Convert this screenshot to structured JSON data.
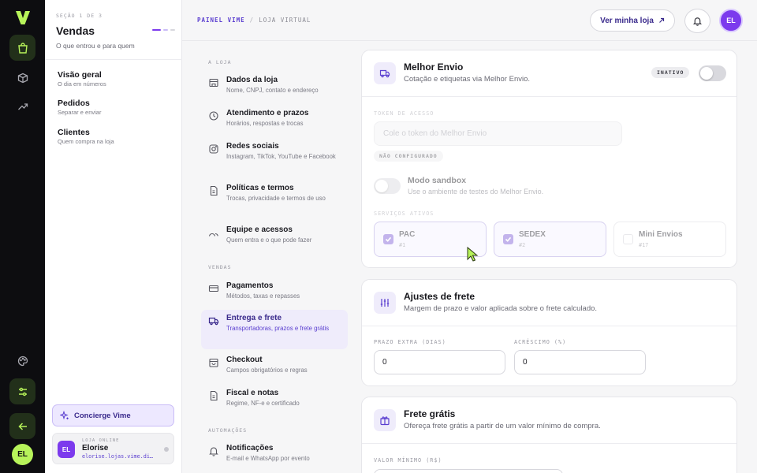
{
  "rail": {
    "logo_icon": "vime-logo-icon",
    "avatar": "EL",
    "accent": "#b7f35a"
  },
  "section": {
    "eyebrow": "SEÇÃO 1 DE 3",
    "title": "Vendas",
    "subtitle": "O que entrou e para quem",
    "items": [
      {
        "title": "Visão geral",
        "subtitle": "O dia em números"
      },
      {
        "title": "Pedidos",
        "subtitle": "Separar e enviar"
      },
      {
        "title": "Clientes",
        "subtitle": "Quem compra na loja"
      }
    ],
    "concierge": "Concierge Vime",
    "store": {
      "eyebrow": "LOJA ONLINE",
      "name": "Elorise",
      "domain": "elorise.lojas.vime.di…",
      "avatar": "EL"
    }
  },
  "header": {
    "breadcrumb": [
      "PAINEL VIME",
      "/",
      "LOJA VIRTUAL"
    ],
    "store_button": "Ver minha loja",
    "avatar": "EL"
  },
  "nav": {
    "groups": [
      "A LOJA",
      "VENDAS",
      "AUTOMAÇÕES"
    ],
    "items": [
      {
        "title": "Dados da loja",
        "subtitle": "Nome, CNPJ, contato e endereço",
        "icon": "store-icon"
      },
      {
        "title": "Atendimento e prazos",
        "subtitle": "Horários, respostas e trocas",
        "icon": "clock-icon"
      },
      {
        "title": "Redes sociais",
        "subtitle": "Instagram, TikTok, YouTube e Facebook",
        "icon": "instagram-icon"
      },
      {
        "title": "Políticas e termos",
        "subtitle": "Trocas, privacidade e termos de uso",
        "icon": "document-icon"
      },
      {
        "title": "Equipe e acessos",
        "subtitle": "Quem entra e o que pode fazer",
        "icon": "team-icon"
      },
      {
        "title": "Pagamentos",
        "subtitle": "Métodos, taxas e repasses",
        "icon": "card-icon"
      },
      {
        "title": "Entrega e frete",
        "subtitle": "Transportadoras, prazos e frete grátis",
        "icon": "truck-icon",
        "active": true
      },
      {
        "title": "Checkout",
        "subtitle": "Campos obrigatórios e regras",
        "icon": "bag-icon"
      },
      {
        "title": "Fiscal e notas",
        "subtitle": "Regime, NF-e e certificado",
        "icon": "invoice-icon"
      },
      {
        "title": "Notificações",
        "subtitle": "E-mail e WhatsApp por evento",
        "icon": "bell-icon"
      }
    ]
  },
  "melhor_envio": {
    "title": "Melhor Envio",
    "subtitle": "Cotação e etiquetas via Melhor Envio.",
    "status_badge": "INATIVO",
    "enabled": false,
    "token_label": "TOKEN DE ACESSO",
    "token_placeholder": "Cole o token do Melhor Envio",
    "token_status": "NÃO CONFIGURADO",
    "sandbox_title": "Modo sandbox",
    "sandbox_subtitle": "Use o ambiente de testes do Melhor Envio.",
    "sandbox_enabled": false,
    "services_label": "SERVIÇOS ATIVOS",
    "services": [
      {
        "name": "PAC",
        "code": "#1",
        "checked": true
      },
      {
        "name": "SEDEX",
        "code": "#2",
        "checked": true
      },
      {
        "name": "Mini Envios",
        "code": "#17",
        "checked": false
      }
    ]
  },
  "ajustes": {
    "title": "Ajustes de frete",
    "subtitle": "Margem de prazo e valor aplicada sobre o frete calculado.",
    "prazo_label": "PRAZO EXTRA (DIAS)",
    "prazo_value": "0",
    "acrescimo_label": "ACRÉSCIMO (%)",
    "acrescimo_value": "0"
  },
  "frete_gratis": {
    "title": "Frete grátis",
    "subtitle": "Ofereça frete grátis a partir de um valor mínimo de compra.",
    "min_label": "VALOR MÍNIMO (R$)"
  },
  "colors": {
    "brand_purple": "#7c3aed",
    "accent_lime": "#b7f35a",
    "rail_bg": "#0d0d10"
  }
}
